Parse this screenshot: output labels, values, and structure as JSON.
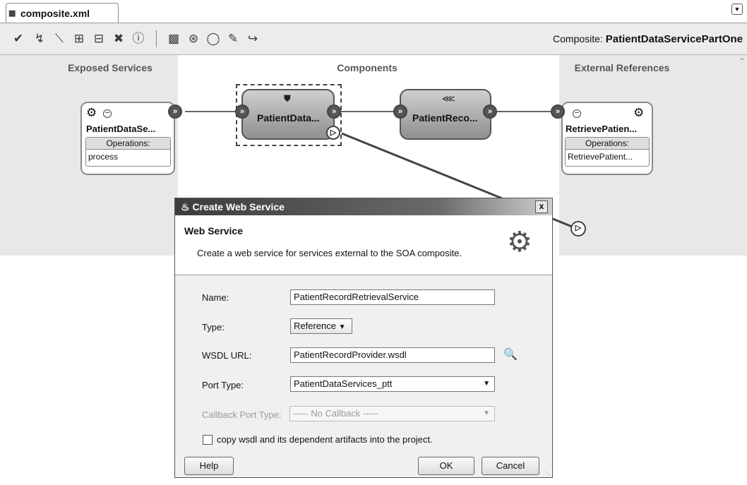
{
  "tab": {
    "title": "composite.xml"
  },
  "toolbar": {
    "composite_label": "Composite:",
    "composite_name": "PatientDataServicePartOne",
    "icons": [
      "validate-icon",
      "lightning-icon",
      "wire-icon",
      "add-icon",
      "remove-icon",
      "delete-icon",
      "info-icon",
      "deploy-icon",
      "tree-icon",
      "refresh-icon",
      "edit-icon",
      "link-icon"
    ]
  },
  "canvas": {
    "lanes": {
      "exposed": "Exposed Services",
      "components": "Components",
      "external": "External References"
    },
    "exposed_service": {
      "name": "PatientDataSe...",
      "ops_header": "Operations:",
      "ops_value": "process"
    },
    "component_1": {
      "name": "PatientData..."
    },
    "component_2": {
      "name": "PatientReco..."
    },
    "external_reference": {
      "name": "RetrievePatien...",
      "ops_header": "Operations:",
      "ops_value": "RetrievePatient..."
    }
  },
  "dialog": {
    "title": "Create Web Service",
    "close": "x",
    "heading": "Web Service",
    "description": "Create a web service for services external to the SOA composite.",
    "name_label": "Name:",
    "name_value": "PatientRecordRetrievalService",
    "type_label": "Type:",
    "type_value": "Reference",
    "wsdl_label": "WSDL URL:",
    "wsdl_value": "PatientRecordProvider.wsdl",
    "port_label": "Port Type:",
    "port_value": "PatientDataServices_ptt",
    "callback_label": "Callback Port Type:",
    "callback_value": "----- No Callback -----",
    "copy_label": "copy wsdl and its dependent artifacts into the project.",
    "copy_checked": false,
    "help": "Help",
    "ok": "OK",
    "cancel": "Cancel"
  }
}
